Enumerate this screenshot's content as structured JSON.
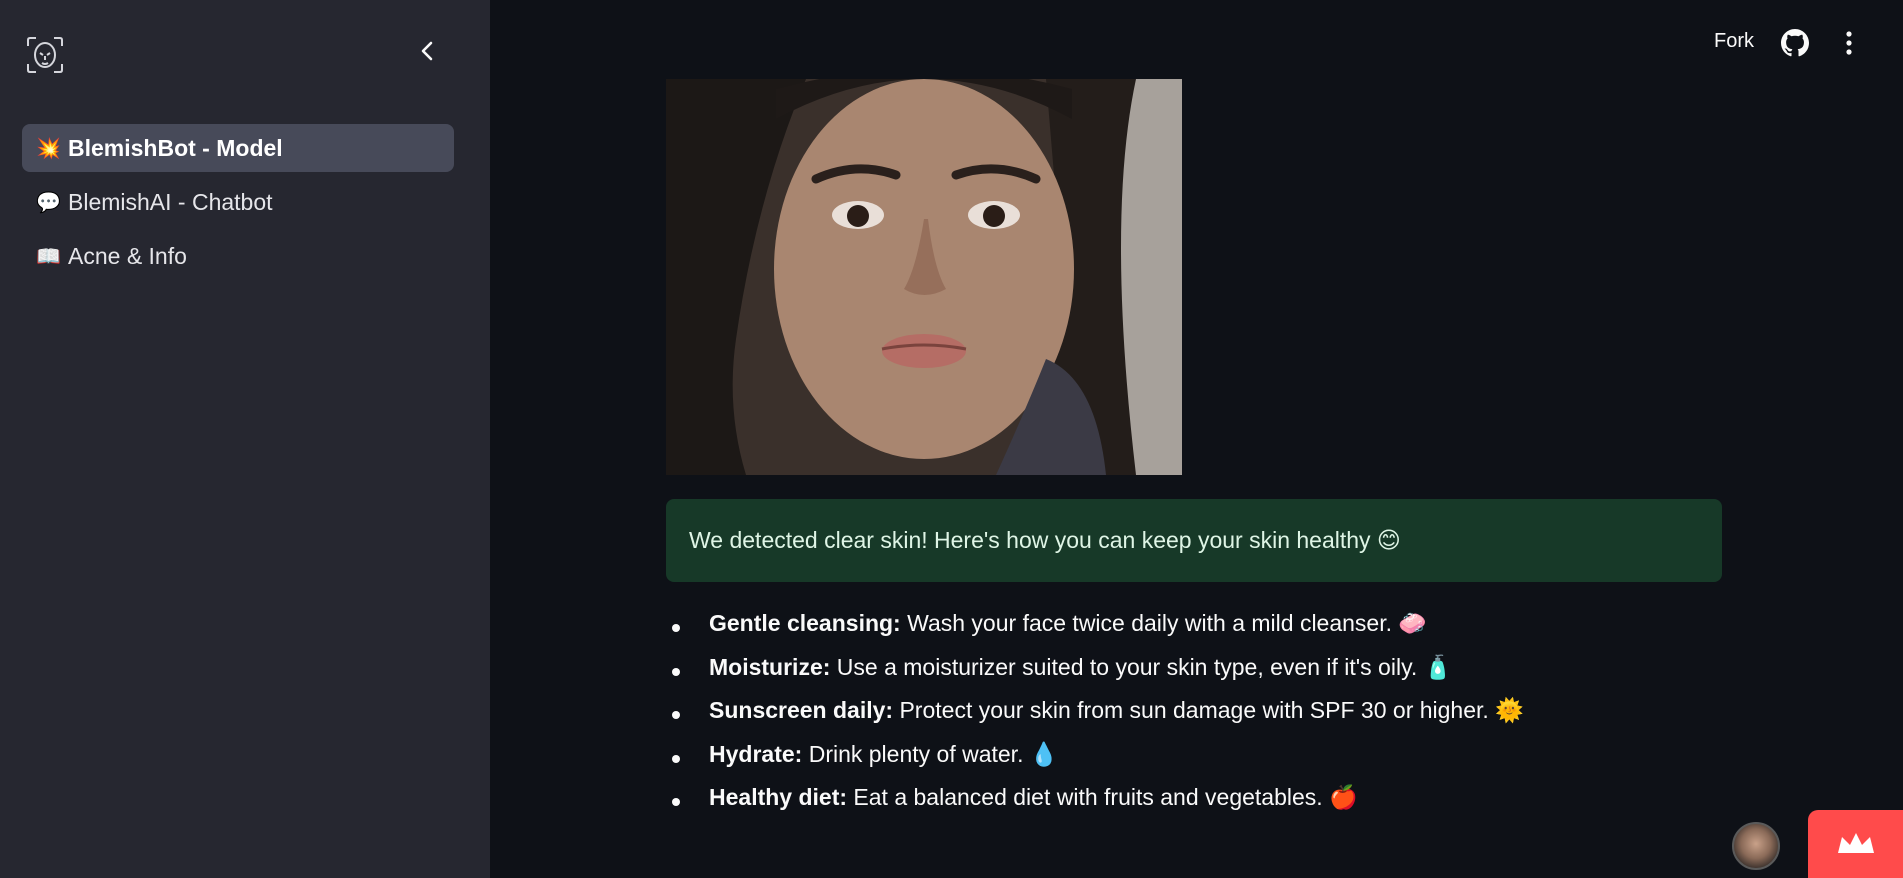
{
  "sidebar": {
    "logo_icon": "face-scan-icon",
    "collapse_icon": "chevron-left-icon",
    "items": [
      {
        "emoji": "💥",
        "label": "BlemishBot - Model",
        "active": true
      },
      {
        "emoji": "💬",
        "label": "BlemishAI - Chatbot",
        "active": false
      },
      {
        "emoji": "📖",
        "label": "Acne & Info",
        "active": false
      }
    ]
  },
  "topbar": {
    "fork_label": "Fork",
    "github_icon": "github-icon",
    "menu_icon": "kebab-menu-icon"
  },
  "main": {
    "image_icon": "uploaded-face-photo",
    "success_message": "We detected clear skin! Here's how you can keep your skin healthy 😊",
    "success_color": "#173928",
    "tips": [
      {
        "title": "Gentle cleansing:",
        "text": " Wash your face twice daily with a mild cleanser. 🧼"
      },
      {
        "title": "Moisturize:",
        "text": " Use a moisturizer suited to your skin type, even if it's oily. 🧴"
      },
      {
        "title": "Sunscreen daily:",
        "text": " Protect your skin from sun damage with SPF 30 or higher. 🌞"
      },
      {
        "title": "Hydrate:",
        "text": " Drink plenty of water. 💧"
      },
      {
        "title": "Healthy diet:",
        "text": " Eat a balanced diet with fruits and vegetables. 🍎"
      }
    ]
  },
  "footer": {
    "avatar_icon": "user-avatar",
    "badge_icon": "streamlit-crown-icon",
    "badge_color": "#ff4b4b"
  }
}
